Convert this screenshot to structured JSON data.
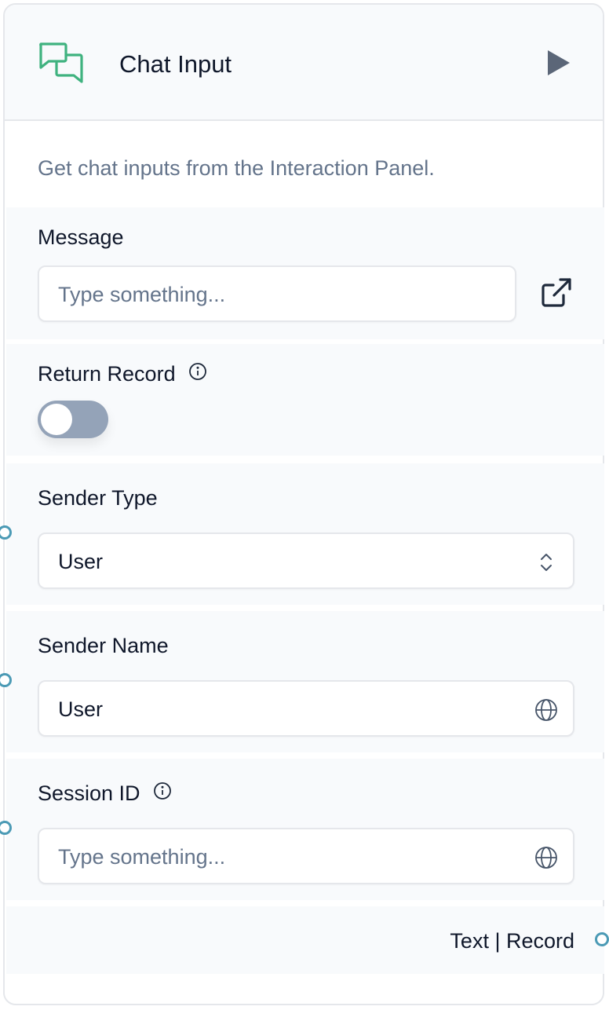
{
  "node": {
    "title": "Chat Input",
    "description": "Get chat inputs from the Interaction Panel.",
    "icon": "chat-bubbles-icon",
    "accent_color": "#3fb27f",
    "handle_color": "#4b9ab5"
  },
  "fields": {
    "message": {
      "label": "Message",
      "placeholder": "Type something..."
    },
    "return_record": {
      "label": "Return Record",
      "enabled": false
    },
    "sender_type": {
      "label": "Sender Type",
      "value": "User"
    },
    "sender_name": {
      "label": "Sender Name",
      "value": "User"
    },
    "session_id": {
      "label": "Session ID",
      "placeholder": "Type something..."
    }
  },
  "output": {
    "label": "Text | Record"
  }
}
